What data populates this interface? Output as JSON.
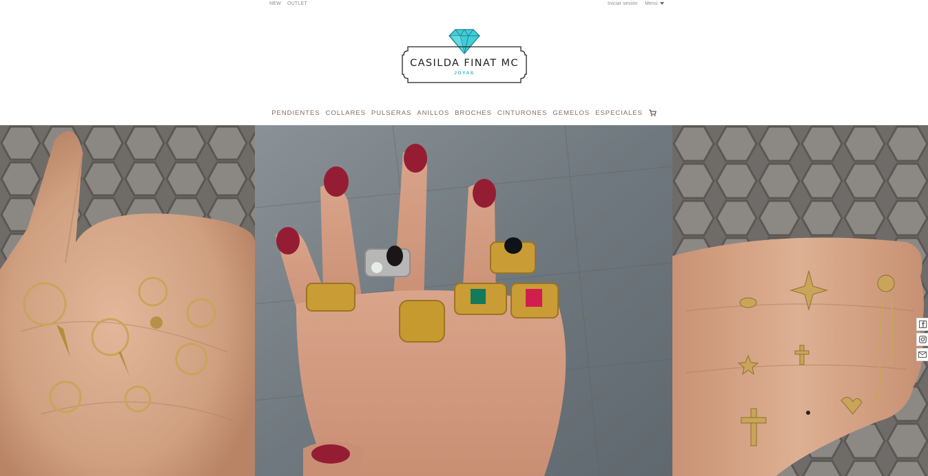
{
  "topbar": {
    "left_links": [
      "NEW",
      "OUTLET"
    ],
    "login": "Iniciar sesión",
    "menu": "Menú",
    "menu_icon": "caret-down-icon"
  },
  "logo": {
    "name": "CASILDA FINAT MC",
    "subtitle": "JOYAS",
    "icon": "diamond-icon",
    "colors": {
      "diamond": "#3cc8d3",
      "text": "#222222",
      "subtitle": "#26b9c7"
    }
  },
  "nav": {
    "items": [
      "PENDIENTES",
      "COLLARES",
      "PULSERAS",
      "ANILLOS",
      "BROCHES",
      "CINTURONES",
      "GEMELOS",
      "ESPECIALES"
    ],
    "cart_icon": "cart-icon",
    "color": "#7d6e66"
  },
  "hero": {
    "panels": [
      {
        "subject": "hand-earrings-photo"
      },
      {
        "subject": "hand-rings-photo"
      },
      {
        "subject": "hand-studs-photo"
      }
    ]
  },
  "social": {
    "icons": [
      "facebook-icon",
      "instagram-icon",
      "mail-icon"
    ]
  }
}
